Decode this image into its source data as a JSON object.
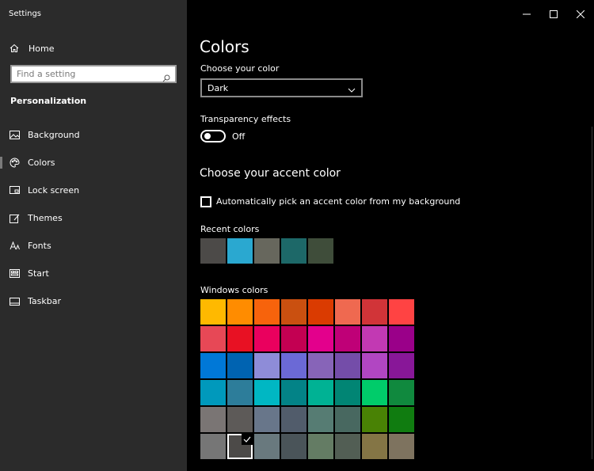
{
  "app": {
    "title": "Settings"
  },
  "sidebar": {
    "home_label": "Home",
    "search_placeholder": "Find a setting",
    "section_heading": "Personalization",
    "items": [
      {
        "label": "Background",
        "icon": "picture-icon"
      },
      {
        "label": "Colors",
        "icon": "palette-icon",
        "selected": true
      },
      {
        "label": "Lock screen",
        "icon": "lock-screen-icon"
      },
      {
        "label": "Themes",
        "icon": "themes-icon"
      },
      {
        "label": "Fonts",
        "icon": "fonts-icon"
      },
      {
        "label": "Start",
        "icon": "start-icon"
      },
      {
        "label": "Taskbar",
        "icon": "taskbar-icon"
      }
    ]
  },
  "main": {
    "title": "Colors",
    "choose_color_label": "Choose your color",
    "choose_color_value": "Dark",
    "transparency_label": "Transparency effects",
    "transparency_state": "Off",
    "accent_heading": "Choose your accent color",
    "auto_accent_label": "Automatically pick an accent color from my background",
    "recent_label": "Recent colors",
    "recent_colors": [
      "#4c4a48",
      "#2aa8d0",
      "#67675d",
      "#1d6868",
      "#3f4d3a"
    ],
    "windows_label": "Windows colors",
    "windows_colors": [
      "#ffb900",
      "#ff8c00",
      "#f7630c",
      "#ca5010",
      "#da3b01",
      "#ef6950",
      "#d13438",
      "#ff4343",
      "#e74856",
      "#e81123",
      "#ea005e",
      "#c30052",
      "#e3008c",
      "#bf0077",
      "#c239b3",
      "#9a0089",
      "#0078d7",
      "#0063b1",
      "#8e8cd8",
      "#6b69d6",
      "#8764b8",
      "#744da9",
      "#b146c2",
      "#881798",
      "#0099bc",
      "#2d7d9a",
      "#00b7c3",
      "#038387",
      "#00b294",
      "#018574",
      "#00cc6a",
      "#10893e",
      "#7a7574",
      "#5d5a58",
      "#68768a",
      "#515c6b",
      "#567c73",
      "#486860",
      "#498205",
      "#107c10",
      "#767676",
      "#4c4a48",
      "#69797e",
      "#4a5459",
      "#647c64",
      "#525e54",
      "#847545",
      "#7e735f"
    ],
    "selected_color_index": 41
  },
  "colors": {
    "sidebar_bg": "#2b2b2b",
    "main_bg": "#000000"
  }
}
